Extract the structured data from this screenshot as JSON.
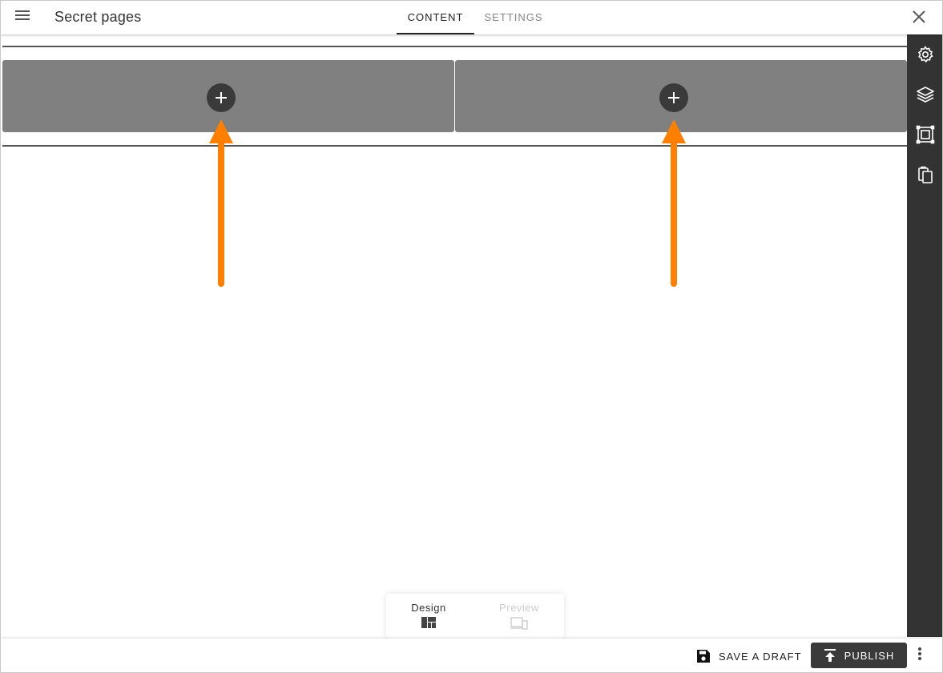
{
  "header": {
    "title": "Secret pages",
    "tabs": [
      {
        "label": "CONTENT",
        "active": true
      },
      {
        "label": "SETTINGS",
        "active": false
      }
    ]
  },
  "right_toolbar": {
    "icons": [
      "gear-icon",
      "layers-icon",
      "frame-select-icon",
      "clipboard-copy-icon"
    ]
  },
  "canvas": {
    "columns": [
      {
        "add_icon": "plus-icon"
      },
      {
        "add_icon": "plus-icon"
      }
    ],
    "annotation_color": "#ff7f00",
    "column_color": "#808080"
  },
  "mode_switch": {
    "design_label": "Design",
    "preview_label": "Preview",
    "active": "Design"
  },
  "footer": {
    "save_label": "SAVE A DRAFT",
    "publish_label": "PUBLISH"
  }
}
